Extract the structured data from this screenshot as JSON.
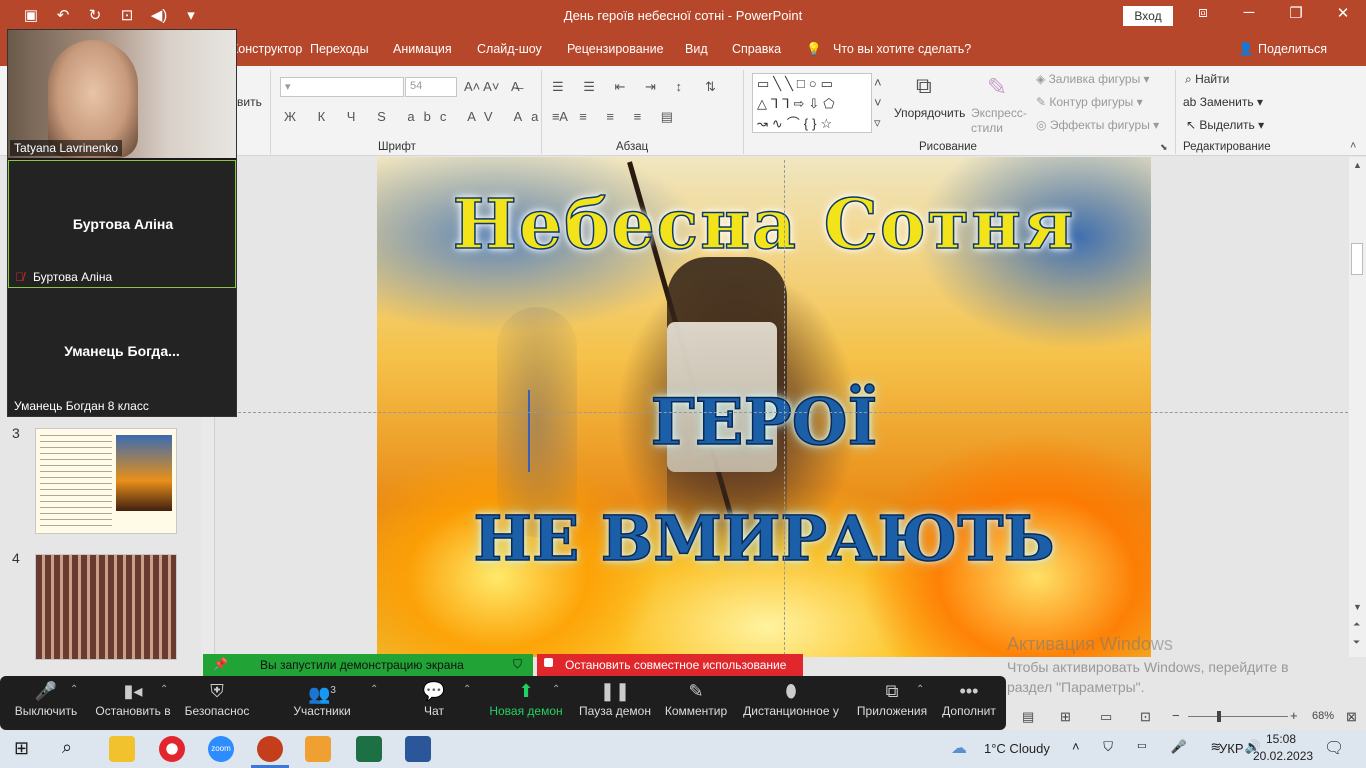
{
  "window": {
    "title": "День героїв небесної сотні  -  PowerPoint",
    "signin_label": "Вход",
    "qat_icons": [
      "save-icon",
      "undo-icon",
      "redo-icon",
      "start-from-beginning-icon",
      "volume-icon",
      "customize-qat-icon"
    ]
  },
  "ribbon": {
    "tabs": [
      "Конструктор",
      "Переходы",
      "Анимация",
      "Слайд-шоу",
      "Рецензирование",
      "Вид",
      "Справка"
    ],
    "tell_me": "Что вы хотите сделать?",
    "share": "Поделиться",
    "font_size": "54",
    "groups": {
      "font": "Шрифт",
      "paragraph": "Абзац",
      "drawing": "Рисование",
      "editing": "Редактирование"
    },
    "paste_partial": "вить",
    "arrange": "Упорядочить",
    "quick_styles": "Экспресс-\nстили",
    "fill": "Заливка фигуры",
    "outline": "Контур фигуры",
    "effects": "Эффекты фигуры",
    "find": "Найти",
    "replace": "Заменить",
    "select": "Выделить"
  },
  "slides_panel": {
    "numbers": [
      "3",
      "4"
    ]
  },
  "slide": {
    "title": "Небесна  Сотня",
    "line2": "ГЕРОЇ",
    "line3": "НЕ  ВМИРАЮТЬ"
  },
  "watermark": {
    "title": "Активация Windows",
    "text": "Чтобы активировать Windows, перейдите в раздел \"Параметры\"."
  },
  "zoom": {
    "participants_panel": [
      {
        "name": "Tatyana Lavrinenko",
        "video": true
      },
      {
        "display": "Буртова Аліна",
        "name": "Буртова Аліна",
        "muted": true,
        "active": true
      },
      {
        "display": "Уманець  Богда...",
        "name": "Уманець Богдан 8 класс"
      }
    ],
    "share_banner": "Вы запустили демонстрацию экрана",
    "stop_share": "Остановить совместное использование",
    "toolbar": [
      {
        "label": "Выключить",
        "icon": "microphone-icon"
      },
      {
        "label": "Остановить в",
        "icon": "video-camera-icon"
      },
      {
        "label": "Безопаснос",
        "icon": "shield-icon"
      },
      {
        "label": "Участники",
        "icon": "participants-icon",
        "count": "3"
      },
      {
        "label": "Чат",
        "icon": "chat-icon"
      },
      {
        "label": "Новая демон",
        "icon": "share-screen-icon"
      },
      {
        "label": "Пауза демон",
        "icon": "pause-icon"
      },
      {
        "label": "Комментир",
        "icon": "pen-icon"
      },
      {
        "label": "Дистанционное у",
        "icon": "mouse-icon"
      },
      {
        "label": "Приложения",
        "icon": "apps-icon"
      },
      {
        "label": "Дополнит",
        "icon": "more-icon"
      }
    ]
  },
  "statusbar": {
    "zoom_level": "68%"
  },
  "taskbar": {
    "weather": "1°C  Cloudy",
    "lang": "УКР",
    "time": "15:08",
    "date": "20.02.2023"
  },
  "colors": {
    "ppt_accent": "#b7472a",
    "zoom_green": "#21a336",
    "zoom_red": "#e0282c"
  }
}
